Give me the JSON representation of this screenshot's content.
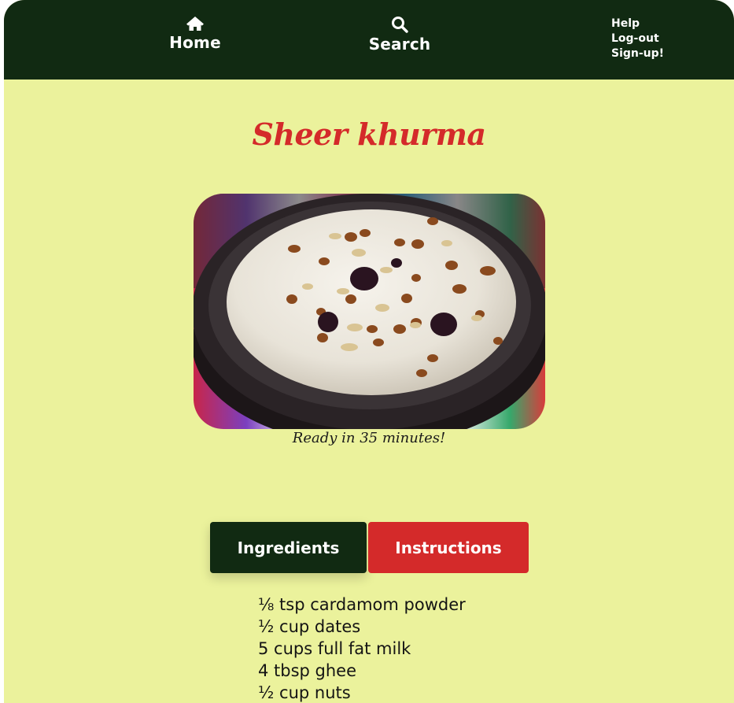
{
  "nav": {
    "home_label": "Home",
    "search_label": "Search",
    "links": [
      "Help",
      "Log-out",
      "Sign-up!"
    ],
    "icons": {
      "home": "home-icon",
      "search": "search-icon"
    },
    "background": "#112a12"
  },
  "recipe": {
    "title": "Sheer khurma",
    "ready_text": "Ready in 35 minutes!",
    "photo_alt": "Bowl of sheer khurma topped with nuts and dates"
  },
  "tabs": {
    "ingredients_label": "Ingredients",
    "instructions_label": "Instructions",
    "active": "Ingredients"
  },
  "ingredients": [
    "⅛ tsp cardamom powder",
    "½ cup dates",
    "5 cups full fat milk",
    "4 tbsp ghee",
    "½ cup nuts"
  ],
  "colors": {
    "page_background": "#ebf29c",
    "accent_red": "#d42a2a",
    "dark_green": "#112a12"
  }
}
